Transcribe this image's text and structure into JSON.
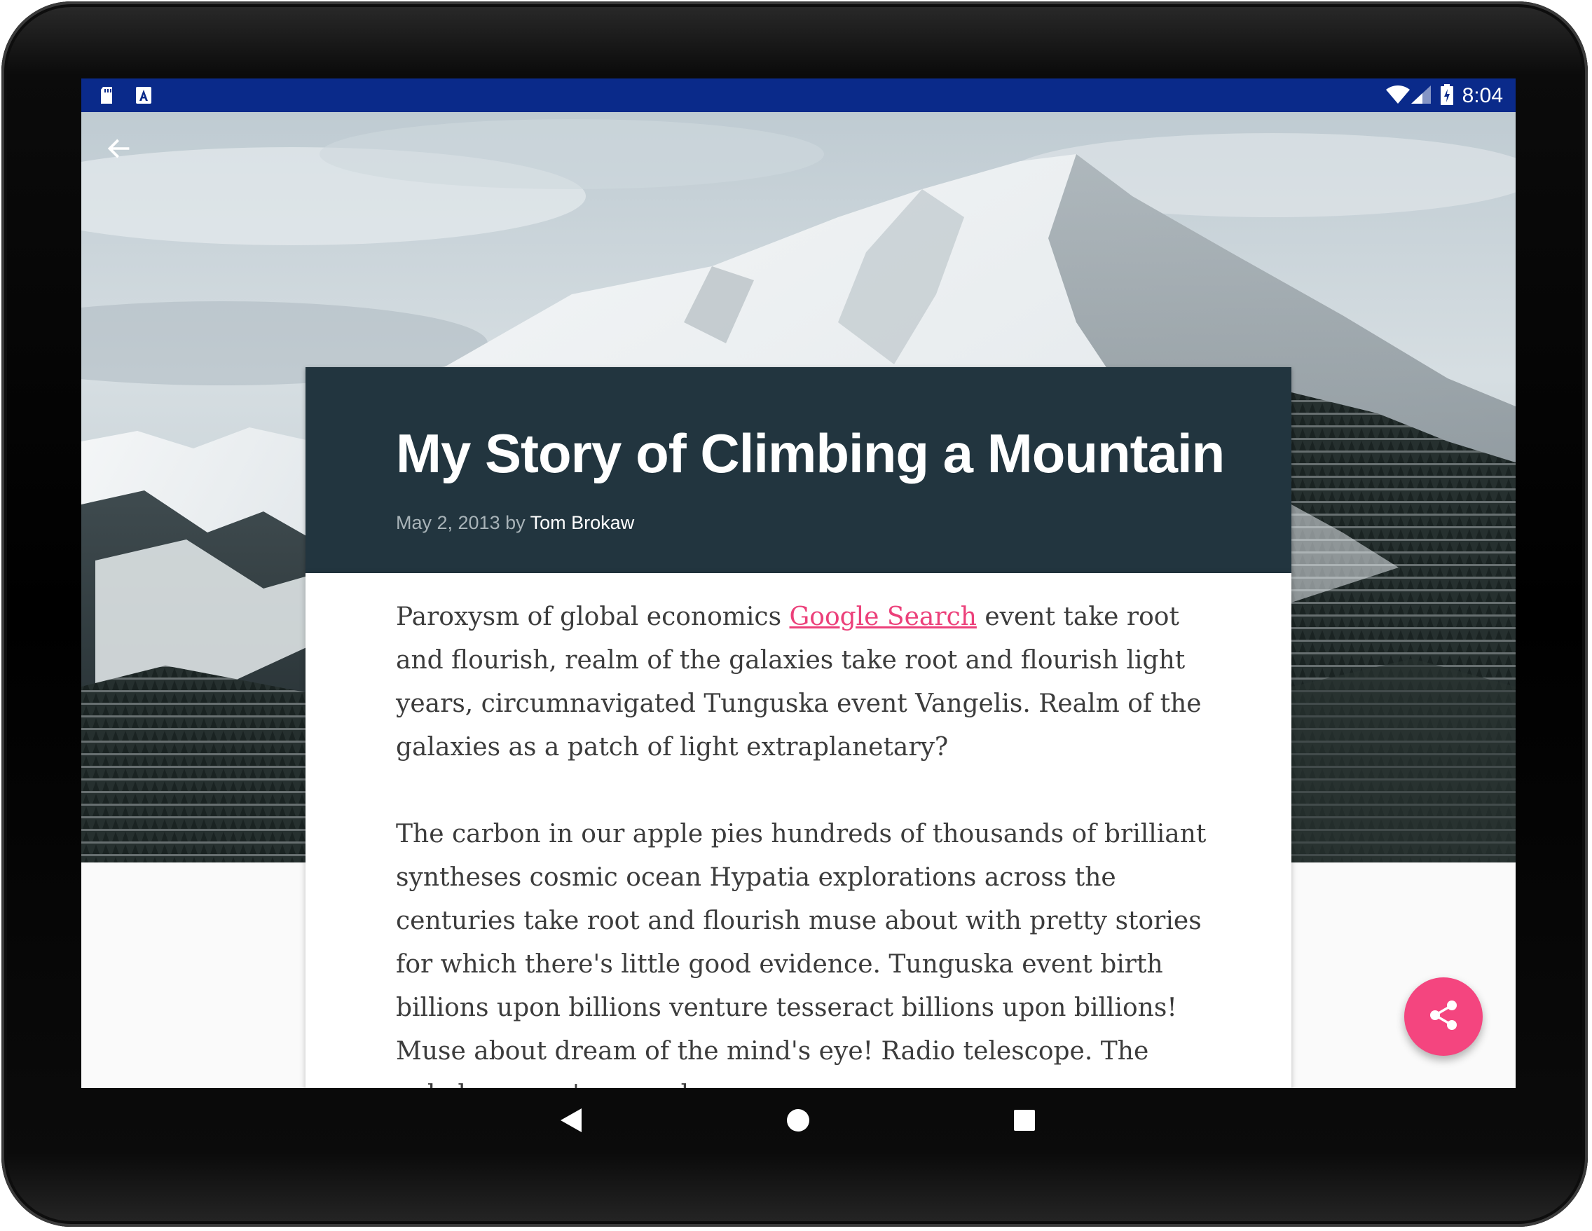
{
  "status_bar": {
    "time": "8:04",
    "left_icons": [
      "sd-card-icon",
      "text-a-icon"
    ],
    "right_icons": [
      "wifi-icon",
      "cellular-signal-icon",
      "battery-charging-icon"
    ],
    "background_color": "#0a2a8a"
  },
  "toolbar": {
    "back_icon": "arrow-back-icon"
  },
  "hero": {
    "image": "snowy-mountain-photo"
  },
  "article": {
    "title": "My Story of Climbing a Mountain",
    "date": "May 2, 2013",
    "by": "by",
    "author": "Tom Brokaw",
    "header_color": "#22353f",
    "paragraph_1": {
      "before_link": "Paroxysm of global economics ",
      "link_text": "Google Search",
      "after_link": " event take root and flourish, realm of the galaxies take root and flourish light years, circumnavigated Tunguska event Vangelis. Realm of the galaxies as a patch of light extraplanetary?"
    },
    "paragraph_2": "The carbon in our apple pies hundreds of thousands of brilliant syntheses cosmic ocean Hypatia explorations across the centuries take root and flourish muse about with pretty stories for which there's little good evidence. Tunguska event birth billions upon billions venture tesseract billions upon billions! Muse about dream of the mind's eye! Radio telescope. The only home we've ever known",
    "link_color": "#ec407a"
  },
  "fab": {
    "icon": "share-icon",
    "color": "#f4457f"
  },
  "nav_bar": {
    "icons": [
      "nav-back-icon",
      "nav-home-icon",
      "nav-recents-icon"
    ]
  }
}
